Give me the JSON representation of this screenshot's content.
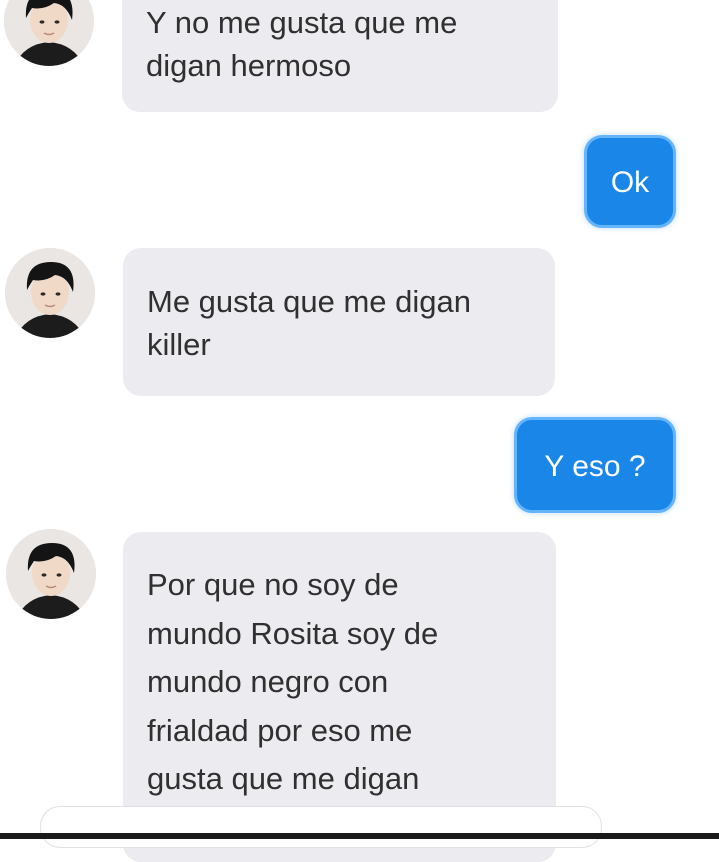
{
  "conversation": {
    "messages": [
      {
        "sender": "contact",
        "text": "Y no me gusta que me\ndigan hermoso"
      },
      {
        "sender": "me",
        "text": "Ok"
      },
      {
        "sender": "contact",
        "text": "Me gusta que me digan\nkiller"
      },
      {
        "sender": "me",
        "text": "Y eso ?"
      },
      {
        "sender": "contact",
        "text": "Por que no soy de\nmundo Rosita soy de\nmundo negro con\nfrialdad por eso me\ngusta que me digan\nkiller"
      }
    ]
  },
  "colors": {
    "outgoing_bubble": "#1a86e8",
    "incoming_bubble": "#ebebf0",
    "background": "#ffffff"
  }
}
